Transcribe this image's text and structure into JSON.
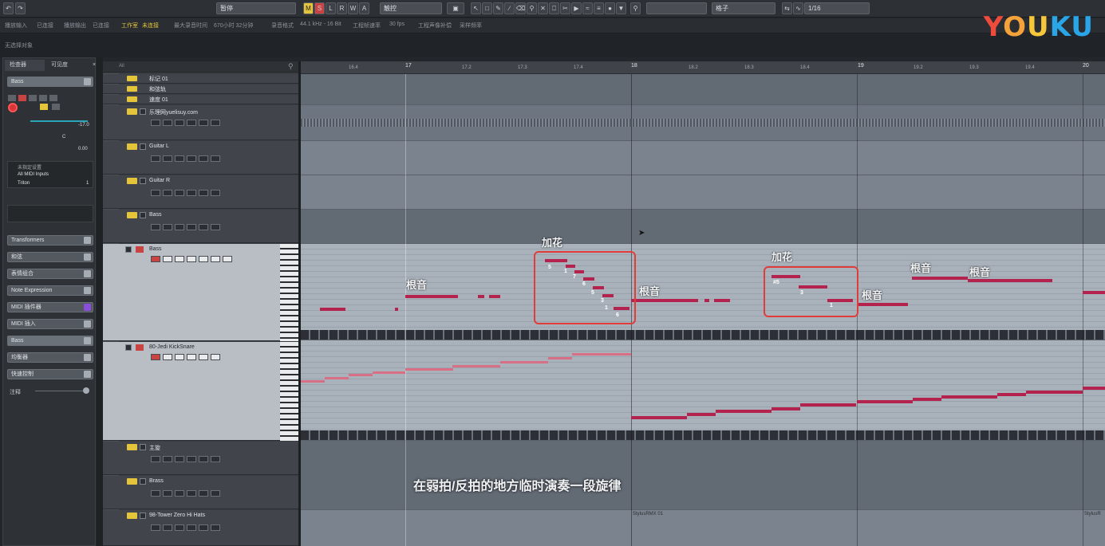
{
  "toolbar": {
    "project_name": "暂停",
    "touch_mode": "触控",
    "snap_type": "格子",
    "quantize": "1/16",
    "mute_label": "M",
    "solo_label": "S",
    "listen_label": "L",
    "read_label": "R",
    "write_label": "W",
    "auto_label": "A"
  },
  "infobar": {
    "items": [
      "播放输入",
      "已连接",
      "播放输出",
      "已连接",
      "工作室",
      "未连接",
      "最大录音时间",
      "670小时 32分钟",
      "录音格式",
      "44.1 kHz - 16 Bit",
      "工程帧速率",
      "30 fps",
      "工程声像补偿",
      "采样频率"
    ]
  },
  "status_text": "无选择对象",
  "watermark": {
    "y": "Y",
    "o1": "O",
    "u1": "U",
    "k": "K",
    "u2": "U"
  },
  "inspector": {
    "tab_main": "检查器",
    "tab_visibility": "可见度",
    "track_name": "Bass",
    "volume_value": "-17.0",
    "pan_value": "C",
    "delay_value": "0.00",
    "input_label": "未指定设置",
    "midi_input": "All MIDI Inputs",
    "output_label": "Triton",
    "channel": "1",
    "sections": [
      "Transformers",
      "和弦",
      "表情组合",
      "Note Expression",
      "MIDI 插件器",
      "MIDI 插入",
      "Bass",
      "均衡器",
      "快速控制",
      "注释"
    ]
  },
  "tracklist": {
    "search_hint": "All",
    "tracks": [
      {
        "name": "标记 01"
      },
      {
        "name": "和弦轨"
      },
      {
        "name": "速度 01"
      },
      {
        "name": "乐理网yuelisuy.com"
      },
      {
        "name": "Guitar L"
      },
      {
        "name": "Guitar R"
      },
      {
        "name": "Bass"
      },
      {
        "name": "Bass"
      },
      {
        "name": "80-Jedi KickSnare"
      },
      {
        "name": "主旋"
      },
      {
        "name": "Brass"
      },
      {
        "name": "98-Tower Zero Hi Hats"
      }
    ]
  },
  "ruler": {
    "bars": [
      "17",
      "18",
      "19",
      "20"
    ],
    "beats": [
      "16.4",
      "17.2",
      "17.3",
      "17.4",
      "18.2",
      "18.3",
      "18.4",
      "19.2",
      "19.3",
      "19.4"
    ]
  },
  "annotations": {
    "root_1": "根音",
    "fill_1": "加花",
    "root_2": "根音",
    "fill_2": "加花",
    "root_3": "根音",
    "root_4": "根音",
    "root_5": "根音",
    "fill1_degrees": [
      "5",
      "1",
      "7",
      "6",
      "5",
      "3",
      "1",
      "6"
    ],
    "fill2_degrees": [
      "#5",
      "3",
      "1"
    ]
  },
  "clips": {
    "stylus_1": "StylusRMX 01",
    "stylus_2": "StylusR"
  },
  "caption": "在弱拍/反拍的地方临时演奏一段旋律"
}
